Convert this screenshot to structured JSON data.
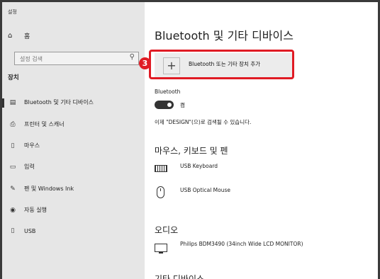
{
  "window": {
    "title": "설정"
  },
  "sidebar": {
    "home_label": "홈",
    "search_placeholder": "설정 검색",
    "section_title": "장치",
    "items": [
      {
        "label": "Bluetooth 및 기타 디바이스",
        "icon": "bluetooth-devices-icon",
        "active": true
      },
      {
        "label": "프린터 및 스캐너",
        "icon": "printer-icon",
        "active": false
      },
      {
        "label": "마우스",
        "icon": "mouse-icon",
        "active": false
      },
      {
        "label": "입력",
        "icon": "keyboard-icon",
        "active": false
      },
      {
        "label": "펜 및 Windows Ink",
        "icon": "pen-icon",
        "active": false
      },
      {
        "label": "자동 실행",
        "icon": "autoplay-icon",
        "active": false
      },
      {
        "label": "USB",
        "icon": "usb-icon",
        "active": false
      }
    ]
  },
  "main": {
    "title": "Bluetooth 및 기타 디바이스",
    "add_device_label": "Bluetooth 또는 기타 장치 추가",
    "annotation_badge": "3",
    "bluetooth_label": "Bluetooth",
    "bluetooth_state": "켬",
    "discoverable_text": "이제 \"DESIGN\"(으)로 검색될 수 있습니다.",
    "mouse_section_title": "마우스, 키보드 및 펜",
    "mouse_devices": [
      {
        "name": "USB Keyboard",
        "icon": "keyboard-device-icon"
      },
      {
        "name": "USB Optical Mouse",
        "icon": "mouse-device-icon"
      }
    ],
    "audio_section_title": "오디오",
    "audio_devices": [
      {
        "name": "Philips BDM3490 (34inch Wide LCD MONITOR)",
        "icon": "monitor-device-icon"
      }
    ],
    "other_section_title": "기타 디바이스"
  },
  "colors": {
    "accent": "#e01b24",
    "sidebar_bg": "#e6e6e6",
    "toggle_on": "#333333"
  }
}
